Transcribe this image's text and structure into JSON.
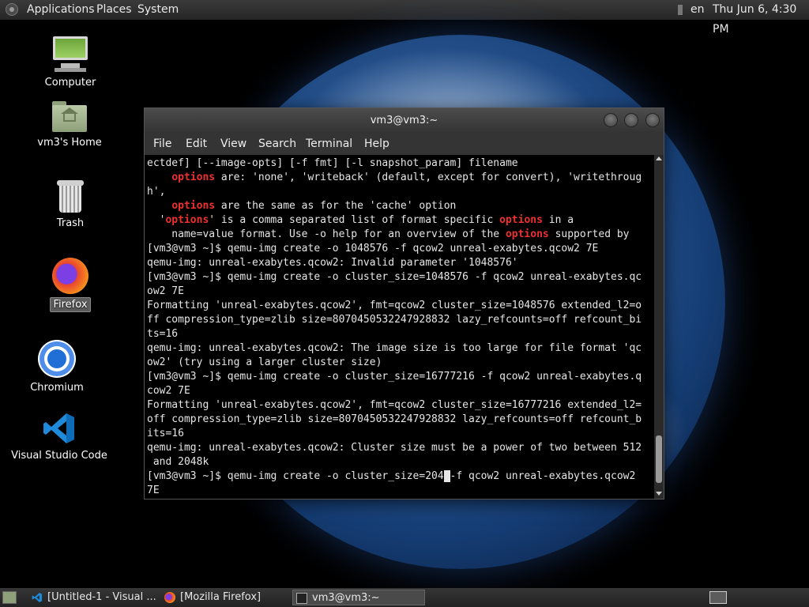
{
  "top_panel": {
    "menus": [
      "Applications",
      "Places",
      "System"
    ],
    "language": "en",
    "clock": "Thu Jun  6,  4:30 PM"
  },
  "desktop": {
    "icons": [
      {
        "label": "Computer",
        "icon": "computer-icon"
      },
      {
        "label": "vm3's Home",
        "icon": "home-folder-icon"
      },
      {
        "label": "Trash",
        "icon": "trash-icon"
      },
      {
        "label": "Firefox",
        "icon": "firefox-icon",
        "selected": true
      },
      {
        "label": "Chromium",
        "icon": "chromium-icon"
      },
      {
        "label": "Visual Studio Code",
        "icon": "vscode-icon"
      }
    ]
  },
  "terminal": {
    "title": "vm3@vm3:~",
    "menu": [
      "File",
      "Edit",
      "View",
      "Search",
      "Terminal",
      "Help"
    ],
    "lines": [
      [
        {
          "t": "ectdef] [--image-opts] [-f fmt] [-l snapshot_param] filename"
        }
      ],
      [
        {
          "t": "    "
        },
        {
          "t": "options",
          "hl": true
        },
        {
          "t": " are: 'none', 'writeback' (default, except for convert), 'writethroug"
        }
      ],
      [
        {
          "t": "h',"
        }
      ],
      [
        {
          "t": "    "
        },
        {
          "t": "options",
          "hl": true
        },
        {
          "t": " are the same as for the 'cache' option"
        }
      ],
      [
        {
          "t": "  '"
        },
        {
          "t": "options",
          "hl": true
        },
        {
          "t": "' is a comma separated list of format specific "
        },
        {
          "t": "options",
          "hl": true
        },
        {
          "t": " in a"
        }
      ],
      [
        {
          "t": "    name=value format. Use -o help for an overview of the "
        },
        {
          "t": "options",
          "hl": true
        },
        {
          "t": " supported by"
        }
      ],
      [
        {
          "t": "[vm3@vm3 ~]$ qemu-img create -o 1048576 -f qcow2 unreal-exabytes.qcow2 7E"
        }
      ],
      [
        {
          "t": "qemu-img: unreal-exabytes.qcow2: Invalid parameter '1048576'"
        }
      ],
      [
        {
          "t": "[vm3@vm3 ~]$ qemu-img create -o cluster_size=1048576 -f qcow2 unreal-exabytes.qc"
        }
      ],
      [
        {
          "t": "ow2 7E"
        }
      ],
      [
        {
          "t": "Formatting 'unreal-exabytes.qcow2', fmt=qcow2 cluster_size=1048576 extended_l2=o"
        }
      ],
      [
        {
          "t": "ff compression_type=zlib size=8070450532247928832 lazy_refcounts=off refcount_bi"
        }
      ],
      [
        {
          "t": "ts=16"
        }
      ],
      [
        {
          "t": "qemu-img: unreal-exabytes.qcow2: The image size is too large for file format 'qc"
        }
      ],
      [
        {
          "t": "ow2' (try using a larger cluster size)"
        }
      ],
      [
        {
          "t": "[vm3@vm3 ~]$ qemu-img create -o cluster_size=16777216 -f qcow2 unreal-exabytes.q"
        }
      ],
      [
        {
          "t": "cow2 7E"
        }
      ],
      [
        {
          "t": "Formatting 'unreal-exabytes.qcow2', fmt=qcow2 cluster_size=16777216 extended_l2="
        }
      ],
      [
        {
          "t": "off compression_type=zlib size=8070450532247928832 lazy_refcounts=off refcount_b"
        }
      ],
      [
        {
          "t": "its=16"
        }
      ],
      [
        {
          "t": "qemu-img: unreal-exabytes.qcow2: Cluster size must be a power of two between 512"
        }
      ],
      [
        {
          "t": " and 2048k"
        }
      ],
      [
        {
          "t": "[vm3@vm3 ~]$ qemu-img create -o cluster_size=204"
        },
        {
          "t": " ",
          "cursor": true
        },
        {
          "t": "-f qcow2 unreal-exabytes.qcow2"
        }
      ],
      [
        {
          "t": "7E"
        }
      ]
    ]
  },
  "taskbar": {
    "tasks": [
      {
        "label": "[Untitled-1 - Visual ...",
        "icon": "vscode-icon"
      },
      {
        "label": "[Mozilla Firefox]",
        "icon": "firefox-icon"
      },
      {
        "label": "vm3@vm3:~",
        "icon": "terminal-icon",
        "active": true
      }
    ]
  },
  "colors": {
    "highlight": "#ef3030",
    "terminal_bg": "#000000",
    "terminal_fg": "#e6e6e6"
  }
}
